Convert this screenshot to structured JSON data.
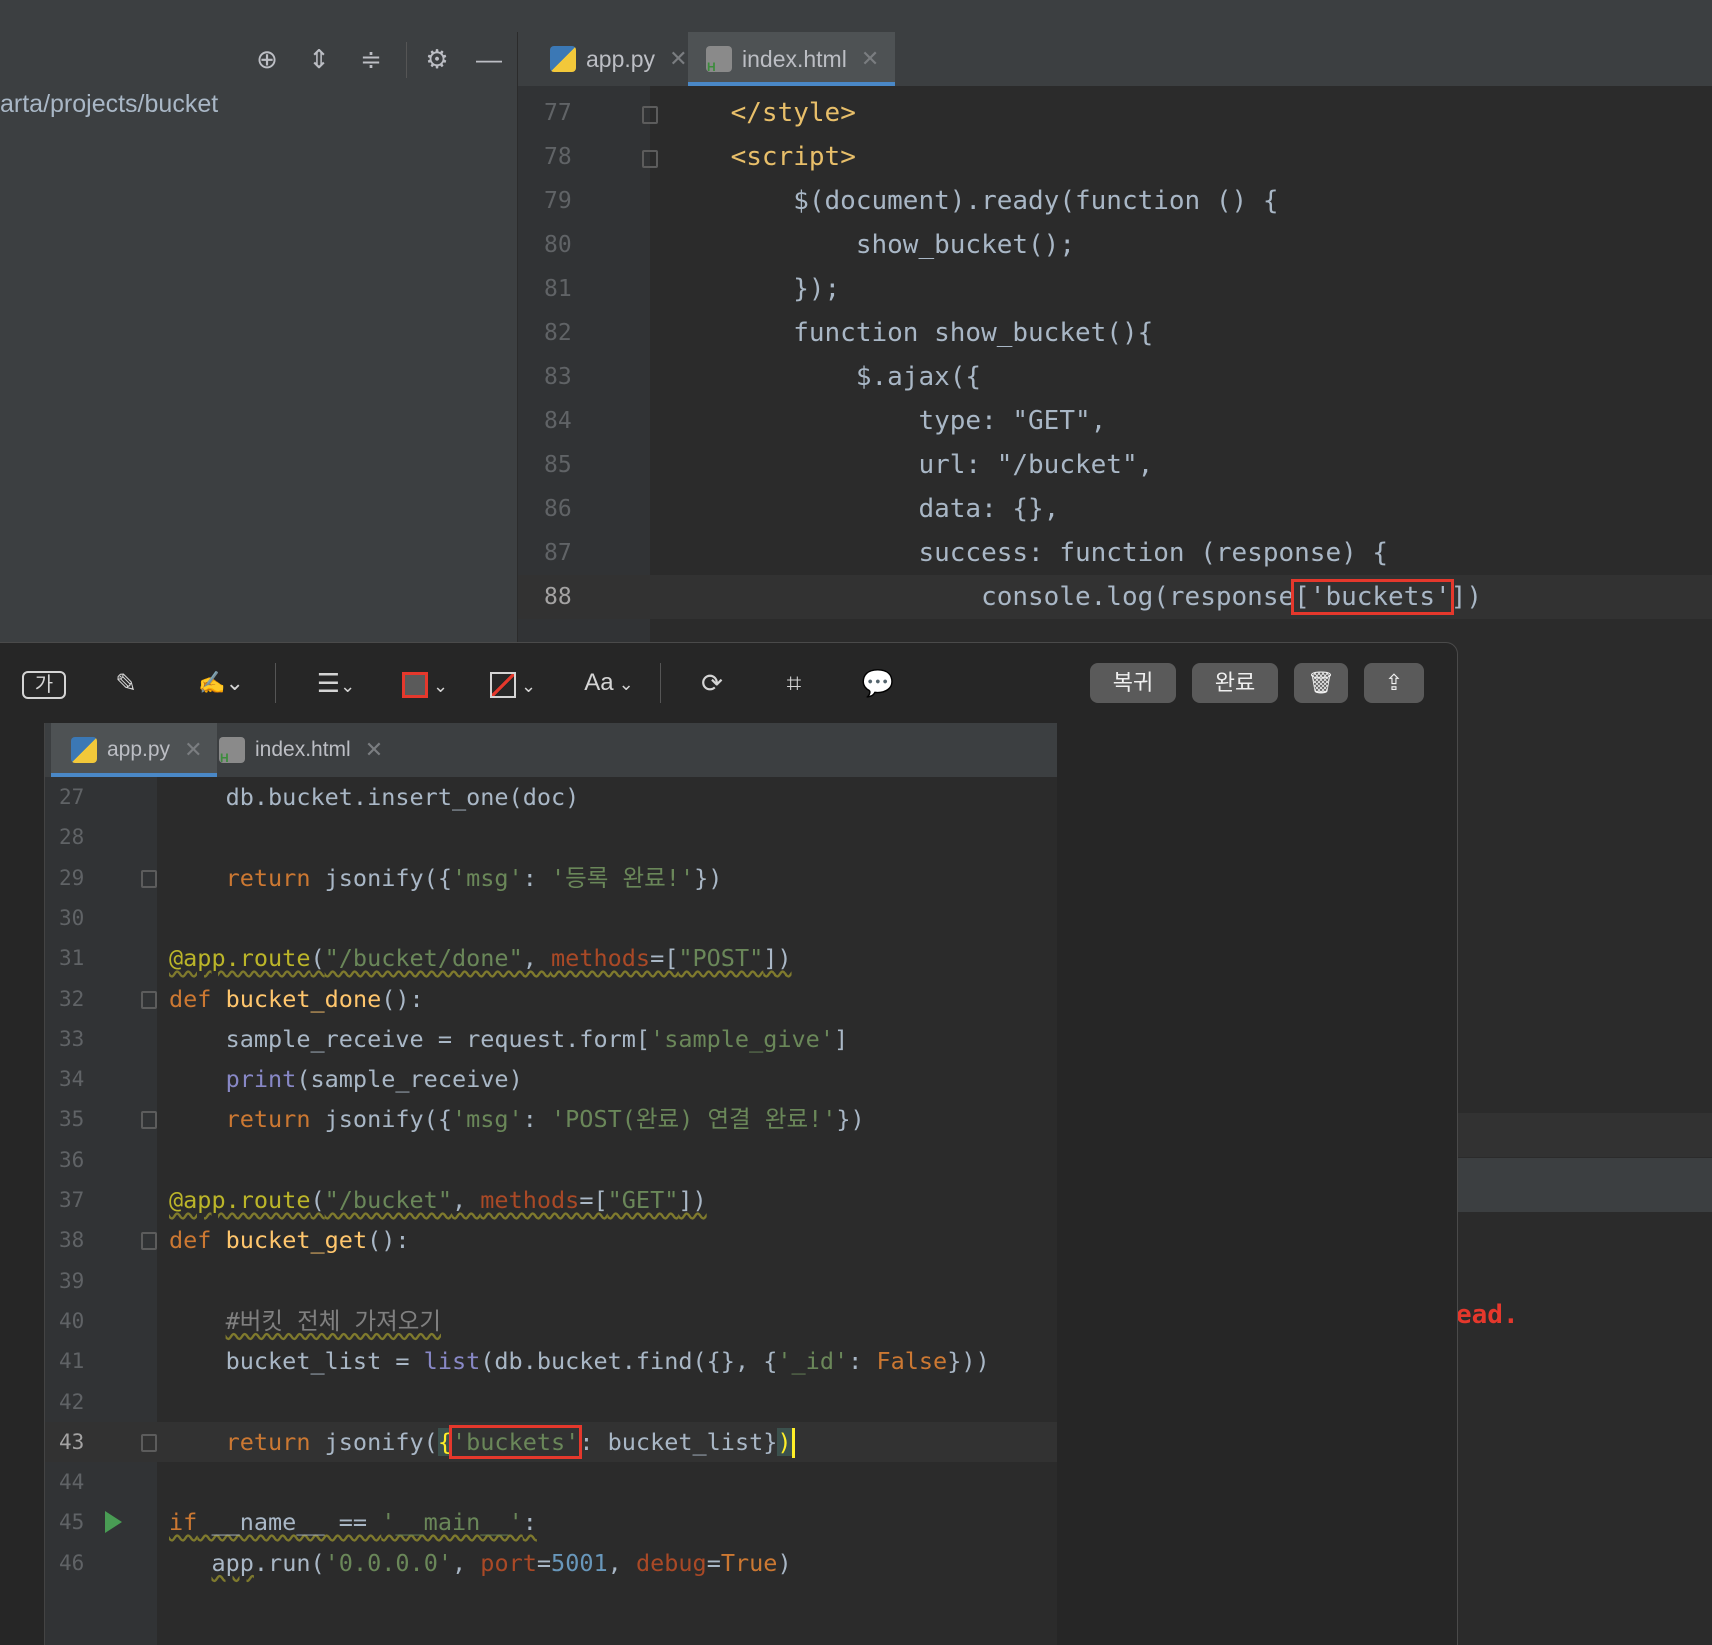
{
  "project_panel": {
    "path": "arta/projects/bucket",
    "toolbar_icons": [
      "locate-icon",
      "expand-all-icon",
      "collapse-all-icon",
      "gear-icon",
      "minimize-icon"
    ]
  },
  "back_editor": {
    "tabs": [
      {
        "label": "app.py",
        "active": false
      },
      {
        "label": "index.html",
        "active": true
      }
    ],
    "lines": [
      {
        "n": "77",
        "html": "    <span class=\"tag\">&lt;/style&gt;</span>"
      },
      {
        "n": "78",
        "html": "    <span class=\"tag\">&lt;script&gt;</span>"
      },
      {
        "n": "79",
        "html": "        $(document).ready(function () {"
      },
      {
        "n": "80",
        "html": "            show_bucket();"
      },
      {
        "n": "81",
        "html": "        });"
      },
      {
        "n": "82",
        "html": "        function show_bucket(){"
      },
      {
        "n": "83",
        "html": "            $.ajax({"
      },
      {
        "n": "84",
        "html": "                type: \"GET\","
      },
      {
        "n": "85",
        "html": "                url: \"/bucket\","
      },
      {
        "n": "86",
        "html": "                data: {},"
      },
      {
        "n": "87",
        "html": "                success: function (response) {"
      },
      {
        "n": "88",
        "html": "                    console.log(response<span class=\"redbox\">['buckets'</span>])"
      }
    ]
  },
  "markup_toolbar": {
    "revert_label": "복귀",
    "done_label": "완료",
    "text_style_label": "Aa",
    "icons": [
      "text-box-icon",
      "pen-icon",
      "signature-icon",
      "line-style-icon",
      "border-color-icon",
      "fill-color-icon",
      "font-icon",
      "rotate-icon",
      "crop-icon",
      "description-icon",
      "trash-icon",
      "share-icon"
    ]
  },
  "front_editor": {
    "tabs": [
      {
        "label": "app.py",
        "active": true
      },
      {
        "label": "index.html",
        "active": false
      }
    ],
    "lines": [
      {
        "n": "27",
        "html": "    db.bucket.insert_one(doc)"
      },
      {
        "n": "28",
        "html": ""
      },
      {
        "n": "29",
        "html": "    <span class=\"kw\">return</span> jsonify({<span class=\"str\">'msg'</span>: <span class=\"str\">'등록 완료!'</span>})"
      },
      {
        "n": "30",
        "html": ""
      },
      {
        "n": "31",
        "html": "<span class=\"wavy\"><span class=\"deco\">@app.route</span>(<span class=\"str\">\"/bucket/done\"</span>, <span class=\"param\">methods</span>=[<span class=\"str\">\"POST\"</span>])</span>"
      },
      {
        "n": "32",
        "html": "<span class=\"kw\">def</span> <span class=\"fn\">bucket_done</span>():"
      },
      {
        "n": "33",
        "html": "    sample_receive = request.form[<span class=\"str\">'sample_give'</span>]"
      },
      {
        "n": "34",
        "html": "    <span class=\"builtin\">print</span>(sample_receive)"
      },
      {
        "n": "35",
        "html": "    <span class=\"kw\">return</span> jsonify({<span class=\"str\">'msg'</span>: <span class=\"str\">'POST(완료) 연결 완료!'</span>})"
      },
      {
        "n": "36",
        "html": ""
      },
      {
        "n": "37",
        "html": "<span class=\"wavy\"><span class=\"deco\">@app.route</span>(<span class=\"str\">\"/bucket\"</span>, <span class=\"param\">methods</span>=[<span class=\"str\">\"GET\"</span>])</span>"
      },
      {
        "n": "38",
        "html": "<span class=\"kw\">def</span> <span class=\"fn\">bucket_get</span>():"
      },
      {
        "n": "39",
        "html": ""
      },
      {
        "n": "40",
        "html": "    <span class=\"cmt wavy\">#버킷 전체 가져오기</span>"
      },
      {
        "n": "41",
        "html": "    bucket_list = <span class=\"builtin\">list</span>(db.bucket.find({}, {<span class=\"str\">'_id'</span>: <span class=\"kw\">False</span>}))"
      },
      {
        "n": "42",
        "html": ""
      },
      {
        "n": "43",
        "html": "    <span class=\"kw\">return</span> jsonify(<span class=\"brace-hl\">{</span><span class=\"redbox\"><span class=\"str\">'buckets'</span></span>: bucket_list}<span class=\"brace-hl\">)</span><span class=\"caret\"></span>"
      },
      {
        "n": "44",
        "html": ""
      },
      {
        "n": "45",
        "html": "<span class=\"wavy\"><span class=\"kw\">if</span> __name__ == <span class=\"str\">'__main__'</span>:</span>"
      },
      {
        "n": "46",
        "html": "   <span class=\"wavy\">app</span>.run(<span class=\"str\">'0.0.0.0'</span>, <span class=\"param\">port</span>=<span class=\"num2\">5001</span>, <span class=\"param\">debug</span>=<span class=\"kw\">True</span>)"
      }
    ]
  },
  "background_fragment": "ead."
}
